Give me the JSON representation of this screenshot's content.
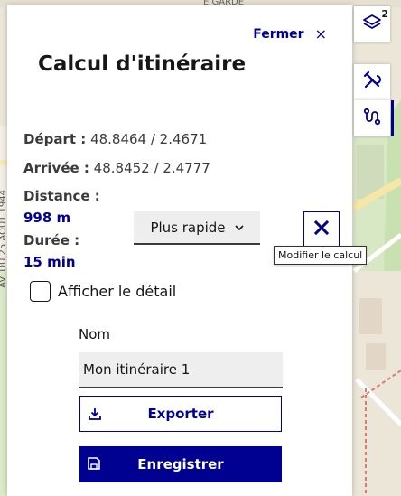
{
  "panel": {
    "close_label": "Fermer",
    "close_icon": "×",
    "title": "Calcul d'itinéraire",
    "depart_label": "Départ :",
    "depart_value": "48.8464 / 2.4671",
    "arrivee_label": "Arrivée :",
    "arrivee_value": "48.8452 / 2.4777",
    "distance_label": "Distance :",
    "distance_value": "998 m",
    "duree_label": "Durée :",
    "duree_value": "15 min",
    "mode_value": "Plus rapide",
    "modify_tooltip": "Modifier le calcul",
    "detail_label": "Afficher le détail",
    "detail_checked": false,
    "nom_label": "Nom",
    "nom_value": "Mon itinéraire 1",
    "export_label": "Exporter",
    "save_label": "Enregistrer"
  },
  "toolbar": {
    "layers_badge": "2",
    "tools": [
      "layers-icon",
      "tools-icon",
      "route-icon"
    ]
  },
  "map": {
    "street_label": "AV. DU 25 AOUT 1944",
    "street_label_top": "E GARDE"
  },
  "colors": {
    "accent": "#000091",
    "panel_bg": "#ffffff",
    "field_bg": "#eeeeee"
  }
}
